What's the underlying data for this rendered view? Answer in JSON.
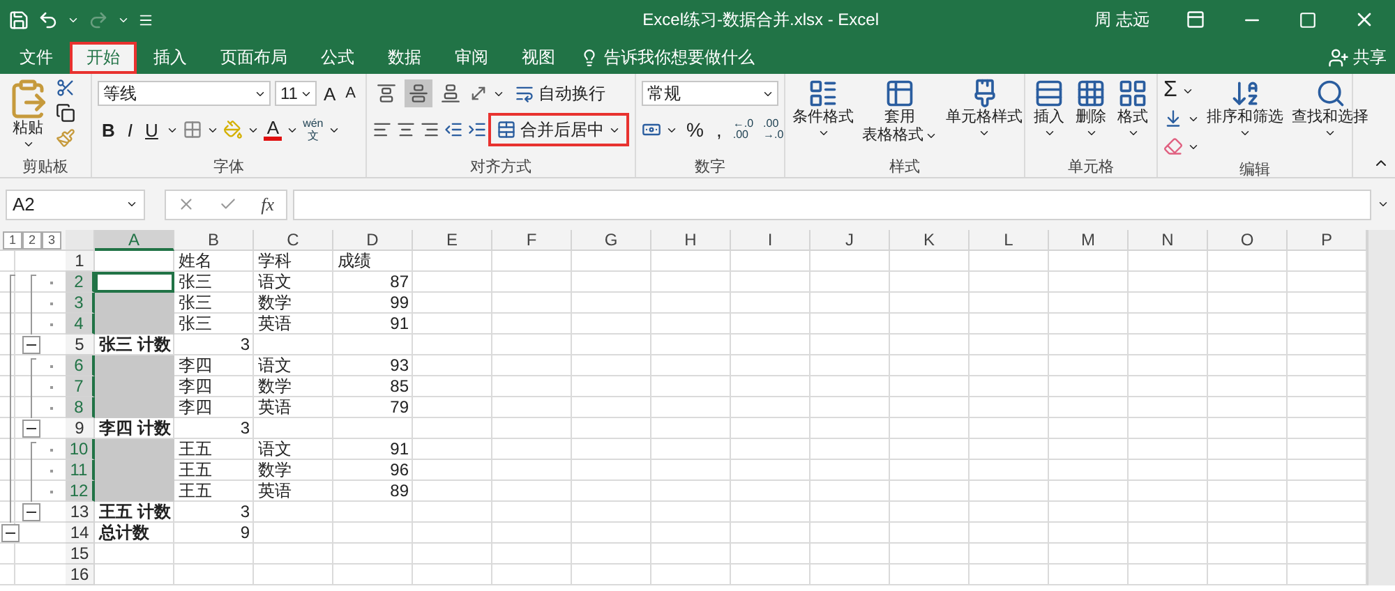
{
  "title_bar": {
    "title": "Excel练习-数据合并.xlsx  -  Excel",
    "user": "周 志远"
  },
  "tabs": [
    {
      "label": "文件",
      "selected": false,
      "highlighted": false
    },
    {
      "label": "开始",
      "selected": true,
      "highlighted": true
    },
    {
      "label": "插入",
      "selected": false,
      "highlighted": false
    },
    {
      "label": "页面布局",
      "selected": false,
      "highlighted": false
    },
    {
      "label": "公式",
      "selected": false,
      "highlighted": false
    },
    {
      "label": "数据",
      "selected": false,
      "highlighted": false
    },
    {
      "label": "审阅",
      "selected": false,
      "highlighted": false
    },
    {
      "label": "视图",
      "selected": false,
      "highlighted": false
    }
  ],
  "tell_me": "告诉我你想要做什么",
  "share": "共享",
  "ribbon": {
    "clipboard": {
      "label": "剪贴板",
      "paste": "粘贴"
    },
    "font": {
      "label": "字体",
      "font_name": "等线",
      "font_size": "11",
      "grow": "A",
      "shrink": "A",
      "bold": "B",
      "italic": "I",
      "underline": "U",
      "font_color": "A",
      "phonetic": [
        "wén",
        "文"
      ]
    },
    "alignment": {
      "label": "对齐方式",
      "vertical": [
        {
          "selected": false
        },
        {
          "selected": true
        },
        {
          "selected": false
        }
      ],
      "wrap_text": "自动换行",
      "merge_center": {
        "label": "合并后居中",
        "highlighted": true
      }
    },
    "number": {
      "label": "数字",
      "format": "常规",
      "percent": "%",
      "comma": ",",
      "increase_decimal": [
        "←.0",
        ".00"
      ],
      "decrease_decimal": [
        ".00",
        "→.0"
      ]
    },
    "styles": {
      "label": "样式",
      "buttons": [
        {
          "lines": [
            "条件格式"
          ]
        },
        {
          "lines": [
            "套用",
            "表格格式"
          ]
        },
        {
          "lines": [
            "单元格样式"
          ]
        }
      ]
    },
    "cells": {
      "label": "单元格",
      "buttons": [
        {
          "lines": [
            "插入"
          ]
        },
        {
          "lines": [
            "删除"
          ]
        },
        {
          "lines": [
            "格式"
          ]
        }
      ]
    },
    "editing": {
      "label": "编辑",
      "sum": "Σ",
      "buttons": [
        {
          "lines": [
            "排序和筛选"
          ]
        },
        {
          "lines": [
            "查找和选择"
          ]
        }
      ]
    }
  },
  "name_box": "A2",
  "fx": "fx",
  "outline_levels": [
    "1",
    "2",
    "3"
  ],
  "columns": [
    {
      "label": "A",
      "selected": true
    },
    {
      "label": "B",
      "selected": false
    },
    {
      "label": "C",
      "selected": false
    },
    {
      "label": "D",
      "selected": false
    },
    {
      "label": "E",
      "selected": false
    },
    {
      "label": "F",
      "selected": false
    },
    {
      "label": "G",
      "selected": false
    },
    {
      "label": "H",
      "selected": false
    },
    {
      "label": "I",
      "selected": false
    },
    {
      "label": "J",
      "selected": false
    },
    {
      "label": "K",
      "selected": false
    },
    {
      "label": "L",
      "selected": false
    },
    {
      "label": "M",
      "selected": false
    },
    {
      "label": "N",
      "selected": false
    },
    {
      "label": "O",
      "selected": false
    },
    {
      "label": "P",
      "selected": false
    }
  ],
  "rows": [
    {
      "num": "1",
      "kind": "header",
      "selected": false,
      "active": false,
      "cells": [
        "",
        "姓名",
        "学科",
        "成绩"
      ]
    },
    {
      "num": "2",
      "kind": "detail",
      "selected": true,
      "active": true,
      "cells": [
        "",
        "张三",
        "语文",
        "87"
      ]
    },
    {
      "num": "3",
      "kind": "detail",
      "selected": true,
      "active": false,
      "cells": [
        "",
        "张三",
        "数学",
        "99"
      ]
    },
    {
      "num": "4",
      "kind": "detail",
      "selected": true,
      "active": false,
      "cells": [
        "",
        "张三",
        "英语",
        "91"
      ]
    },
    {
      "num": "5",
      "kind": "subtotal",
      "selected": false,
      "active": false,
      "expanded": true,
      "cells": [
        "张三 计数",
        "3"
      ]
    },
    {
      "num": "6",
      "kind": "detail",
      "selected": true,
      "active": false,
      "cells": [
        "",
        "李四",
        "语文",
        "93"
      ]
    },
    {
      "num": "7",
      "kind": "detail",
      "selected": true,
      "active": false,
      "cells": [
        "",
        "李四",
        "数学",
        "85"
      ]
    },
    {
      "num": "8",
      "kind": "detail",
      "selected": true,
      "active": false,
      "cells": [
        "",
        "李四",
        "英语",
        "79"
      ]
    },
    {
      "num": "9",
      "kind": "subtotal",
      "selected": false,
      "active": false,
      "expanded": true,
      "cells": [
        "李四 计数",
        "3"
      ]
    },
    {
      "num": "10",
      "kind": "detail",
      "selected": true,
      "active": false,
      "cells": [
        "",
        "王五",
        "语文",
        "91"
      ]
    },
    {
      "num": "11",
      "kind": "detail",
      "selected": true,
      "active": false,
      "cells": [
        "",
        "王五",
        "数学",
        "96"
      ]
    },
    {
      "num": "12",
      "kind": "detail",
      "selected": true,
      "active": false,
      "cells": [
        "",
        "王五",
        "英语",
        "89"
      ]
    },
    {
      "num": "13",
      "kind": "subtotal",
      "selected": false,
      "active": false,
      "expanded": true,
      "cells": [
        "王五 计数",
        "3"
      ]
    },
    {
      "num": "14",
      "kind": "total",
      "selected": false,
      "active": false,
      "expanded": true,
      "cells": [
        "总计数",
        "9"
      ]
    },
    {
      "num": "15",
      "kind": "blank",
      "selected": false,
      "active": false,
      "cells": []
    },
    {
      "num": "16",
      "kind": "blank",
      "selected": false,
      "active": false,
      "cells": []
    }
  ]
}
